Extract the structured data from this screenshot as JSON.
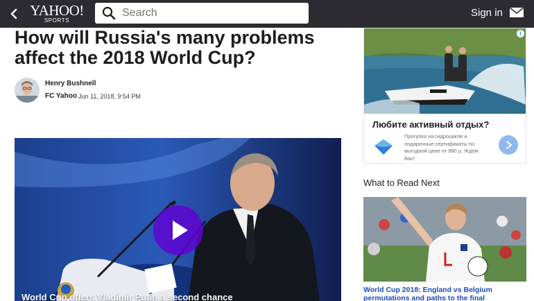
{
  "header": {
    "logo_main": "YAHOO!",
    "logo_sub": "SPORTS",
    "search_placeholder": "Search",
    "signin_label": "Sign in",
    "icons": {
      "back": "chevron-left-icon",
      "search": "search-icon",
      "mail": "mail-icon"
    }
  },
  "article": {
    "title": "How will Russia's many problems affect the 2018 World Cup?",
    "author": "Henry Bushnell",
    "source": "FC Yahoo",
    "date": "Jun 11, 2018, 9:54 PM",
    "video_caption": "World Cup offers Vladimir Putin a second chance"
  },
  "ad": {
    "title": "Любите активный отдых?",
    "text": "Прогулка на гидроцикле и подарочные сертификаты по выгодной цене от 980 р. Ждем Вас!",
    "adchoices": "i"
  },
  "next": {
    "heading": "What to Read Next",
    "items": [
      {
        "title": "World Cup 2018: England vs Belgium permutations and paths to the final"
      }
    ]
  },
  "colors": {
    "topbar": "#2b2b31",
    "play_button": "#6001d2",
    "link": "#1a4ab8",
    "ad_cta": "#8fb8ee"
  }
}
